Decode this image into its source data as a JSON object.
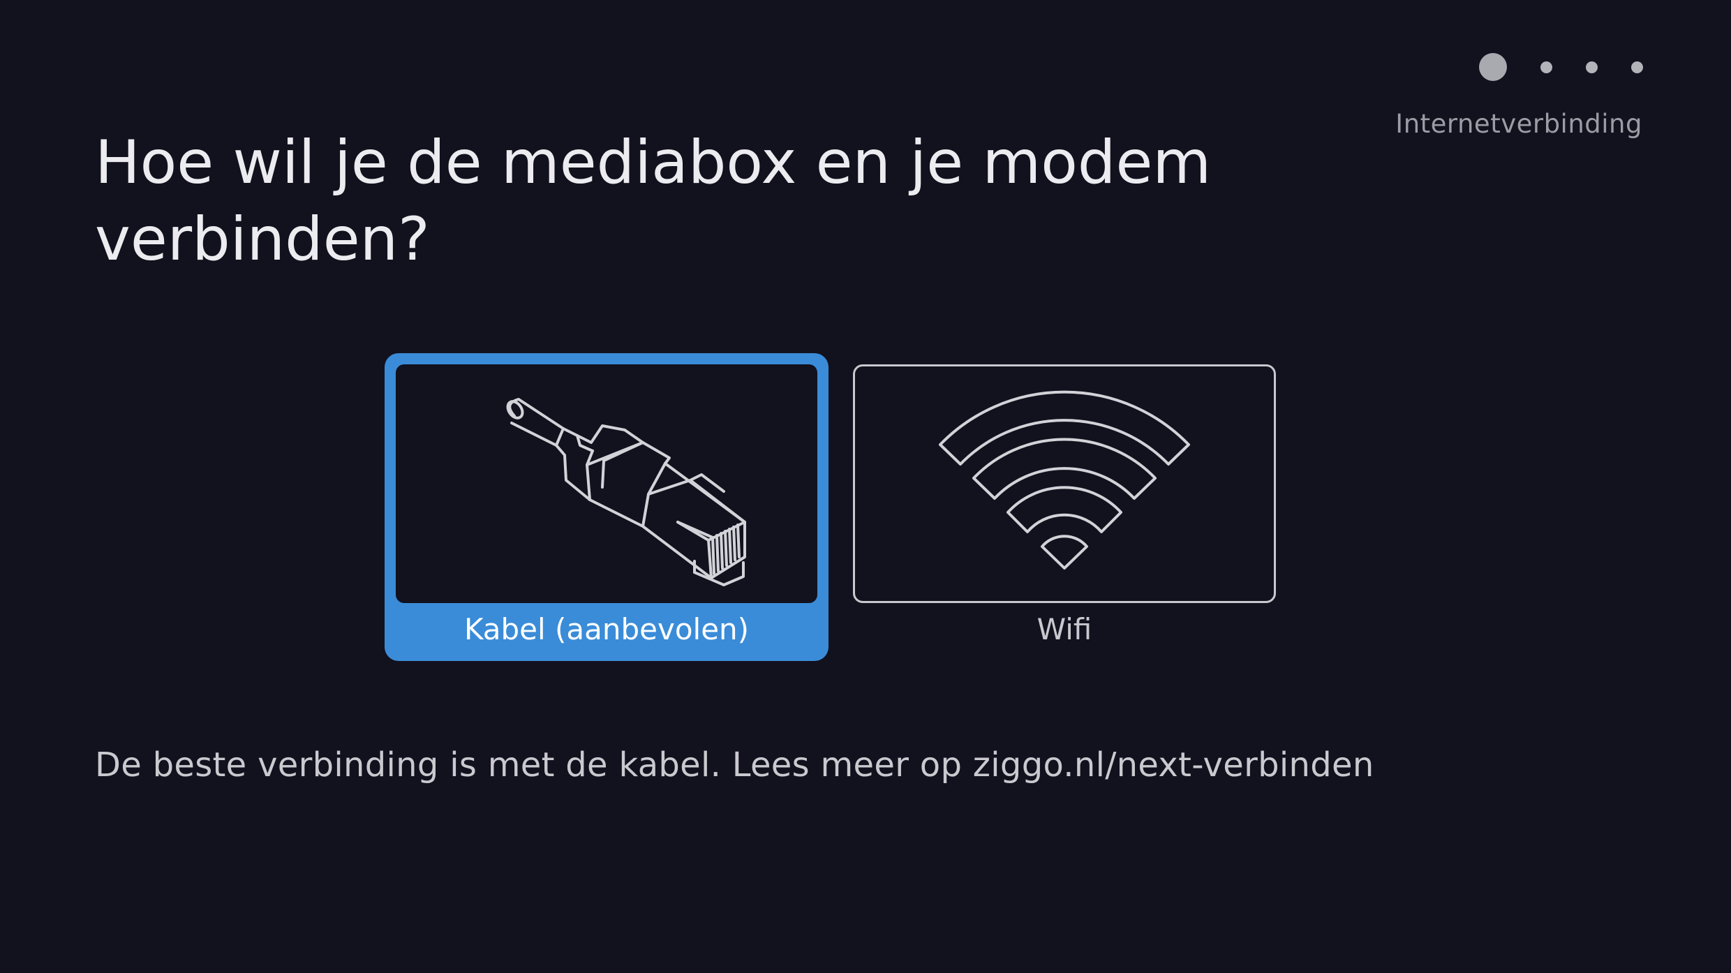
{
  "progress": {
    "step_name": "Internetverbinding",
    "current_step": 1,
    "total_steps": 4
  },
  "title": "Hoe wil je de mediabox en je modem verbinden?",
  "options": [
    {
      "label": "Kabel (aanbevolen)",
      "icon": "ethernet-cable-icon",
      "selected": true
    },
    {
      "label": "Wifi",
      "icon": "wifi-icon",
      "selected": false
    }
  ],
  "info": "De beste verbinding is met de kabel. Lees meer op ziggo.nl/next-verbinden",
  "colors": {
    "background": "#12111e",
    "accent": "#3a8cd8",
    "text": "#ececf0",
    "muted": "#9c9ca4"
  }
}
